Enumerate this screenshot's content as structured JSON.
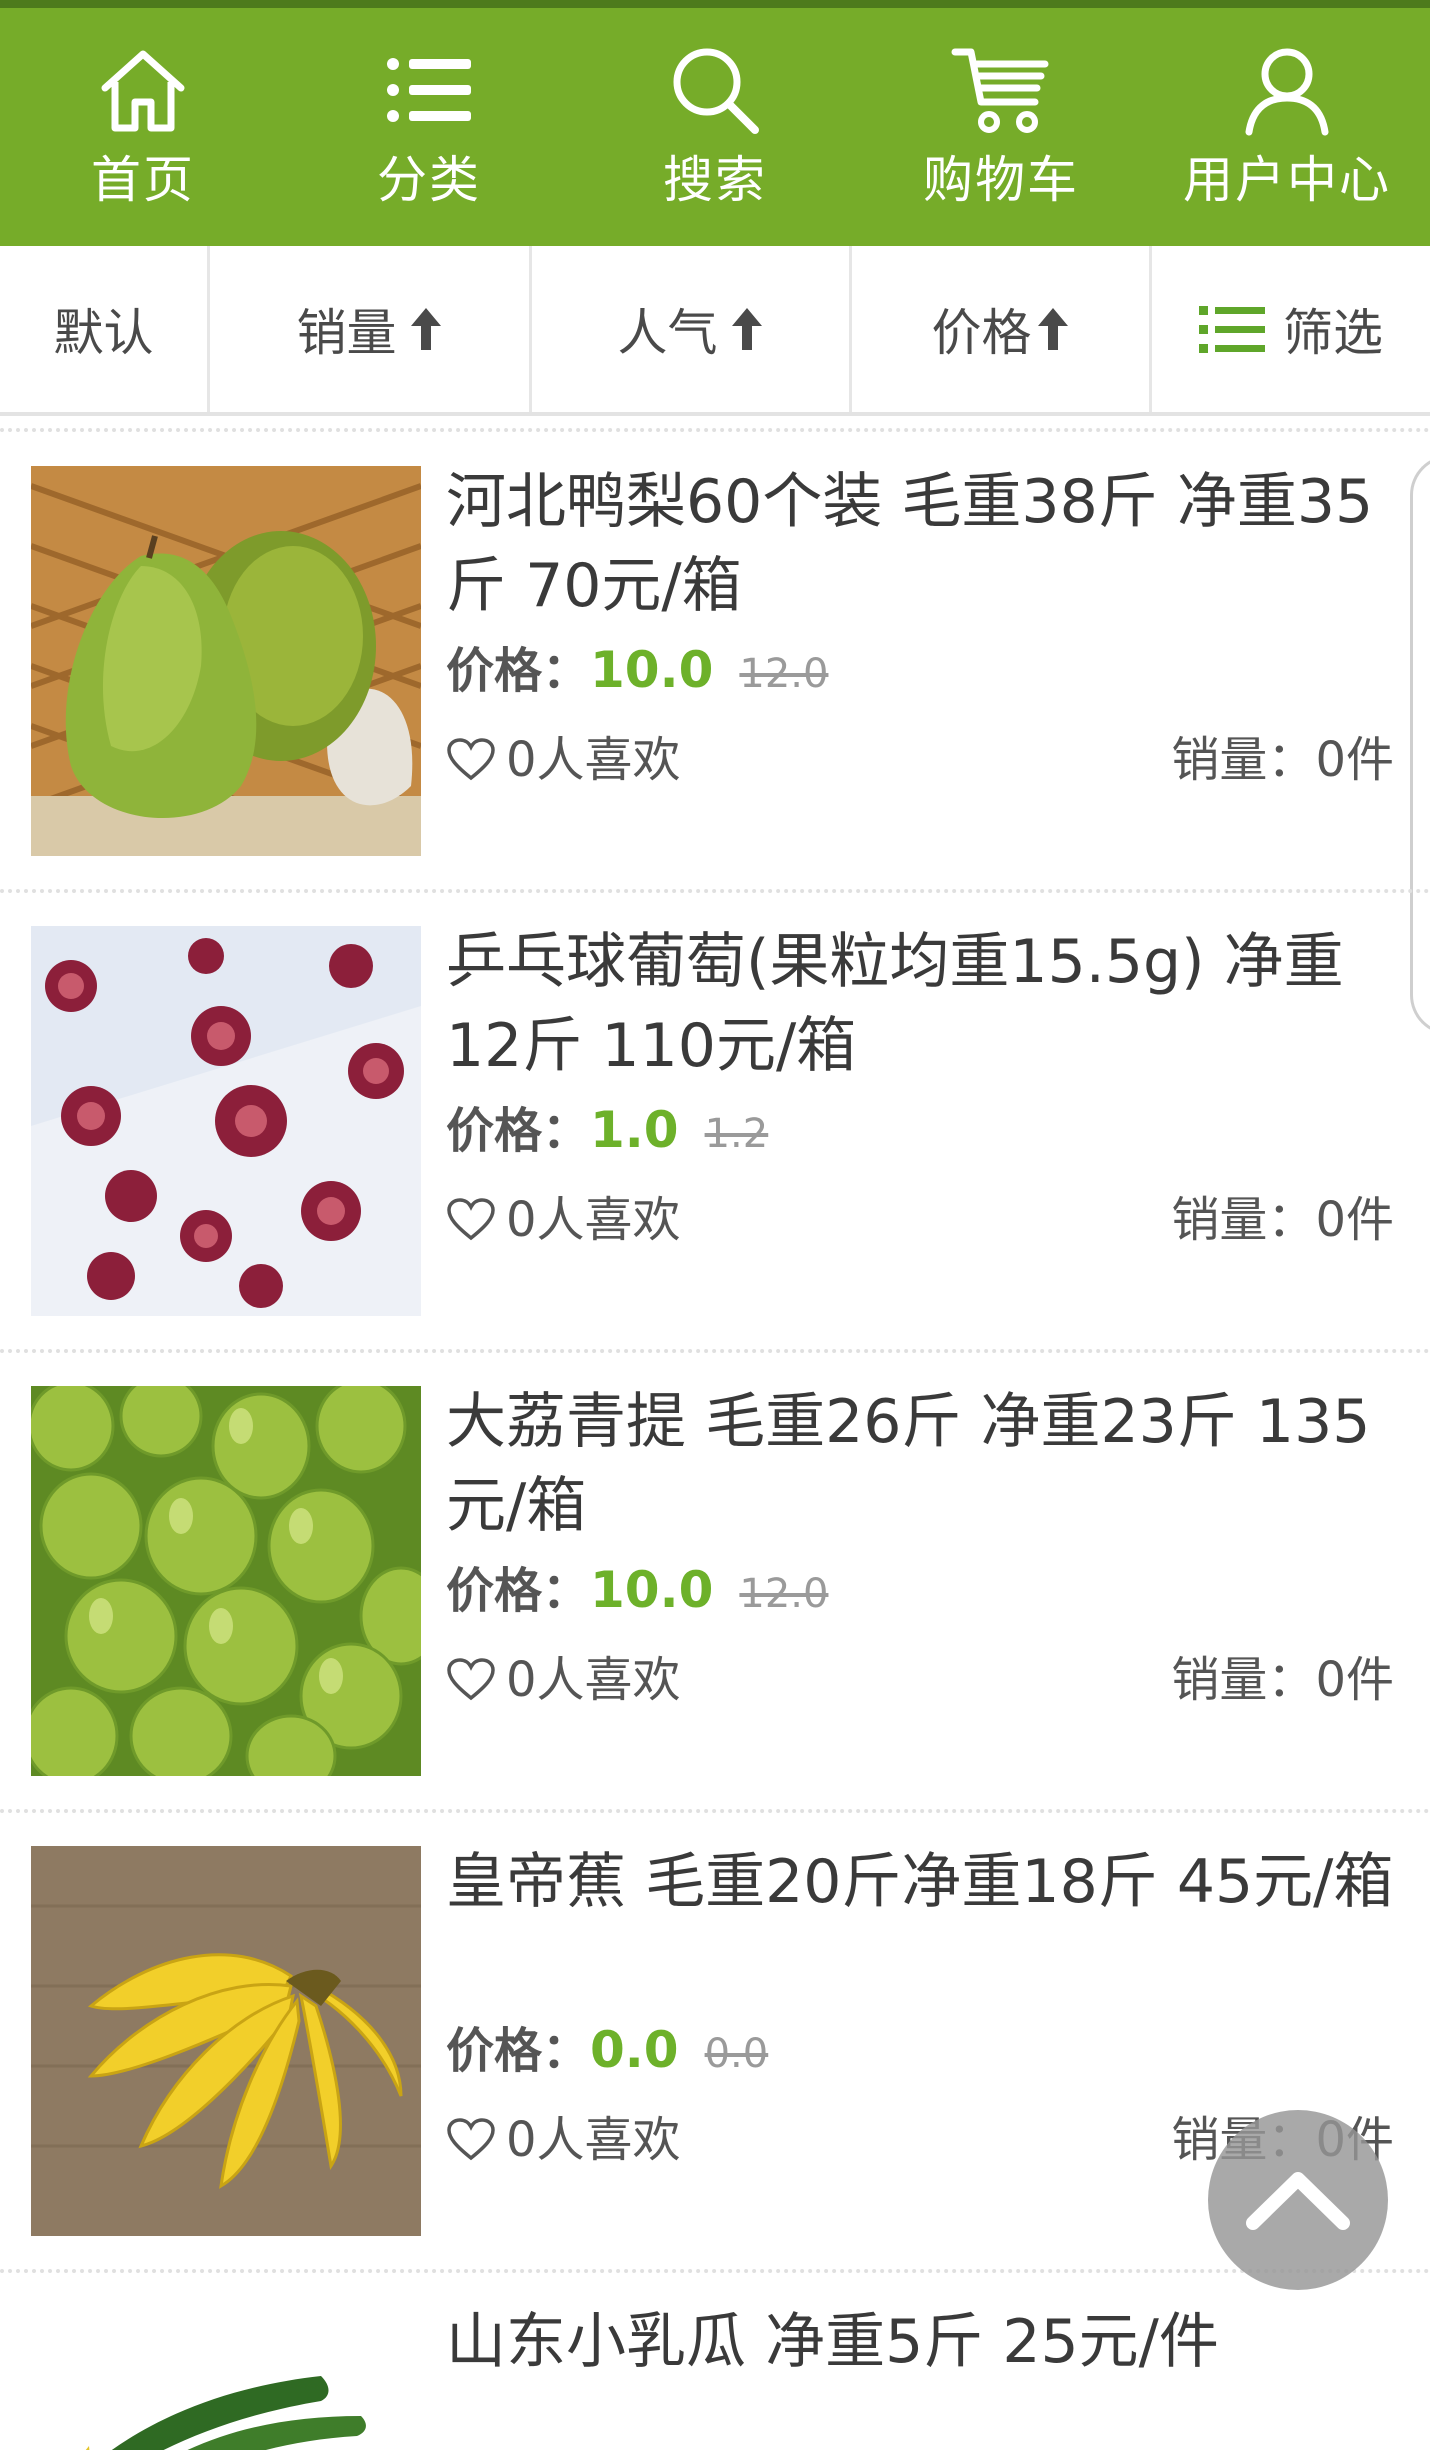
{
  "nav": {
    "items": [
      {
        "label": "首页",
        "icon": "home-icon"
      },
      {
        "label": "分类",
        "icon": "list-icon"
      },
      {
        "label": "搜索",
        "icon": "search-icon"
      },
      {
        "label": "购物车",
        "icon": "cart-icon"
      },
      {
        "label": "用户中心",
        "icon": "user-icon"
      }
    ]
  },
  "sort": {
    "default": "默认",
    "sales": "销量",
    "popularity": "人气",
    "price": "价格",
    "filter": "筛选"
  },
  "labels": {
    "price_prefix": "价格：",
    "likes_suffix": "人喜欢",
    "sales_prefix": "销量：",
    "sales_unit": "件"
  },
  "products": [
    {
      "title": "河北鸭梨60个装 毛重38斤 净重35斤 70元/箱",
      "price": "10.0",
      "original_price": "12.0",
      "likes": "0",
      "sales": "0"
    },
    {
      "title": "乒乓球葡萄(果粒均重15.5g) 净重12斤 110元/箱",
      "price": "1.0",
      "original_price": "1.2",
      "likes": "0",
      "sales": "0"
    },
    {
      "title": "大荔青提 毛重26斤 净重23斤 135元/箱",
      "price": "10.0",
      "original_price": "12.0",
      "likes": "0",
      "sales": "0"
    },
    {
      "title": "皇帝蕉 毛重20斤净重18斤 45元/箱",
      "price": "0.0",
      "original_price": "0.0",
      "likes": "0",
      "sales": "0"
    },
    {
      "title": "山东小乳瓜 净重5斤 25元/件",
      "price": "",
      "original_price": "",
      "likes": "",
      "sales": ""
    }
  ],
  "colors": {
    "brand_green": "#76ac29",
    "price_green": "#6db12a",
    "text_dark": "#3a3a3a",
    "back_top_bg": "#969696"
  }
}
